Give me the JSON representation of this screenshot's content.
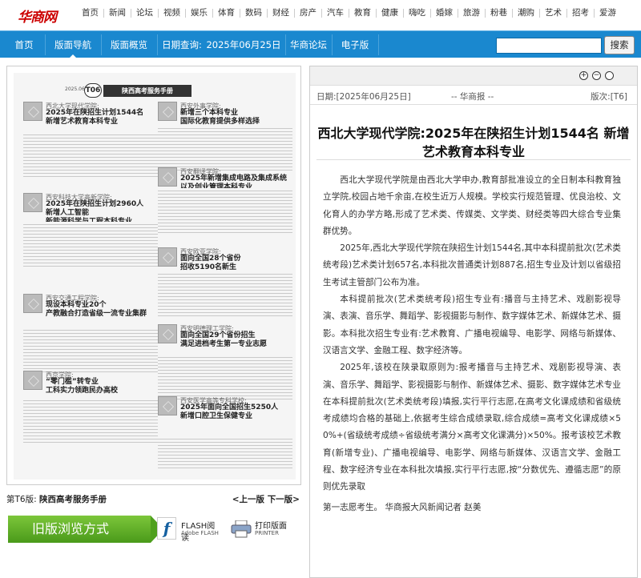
{
  "site": {
    "logo_text": "华商网"
  },
  "topnav": [
    "首页",
    "新闻",
    "论坛",
    "视频",
    "娱乐",
    "体育",
    "数码",
    "财经",
    "房产",
    "汽车",
    "教育",
    "健康",
    "嗨吃",
    "婚嫁",
    "旅游",
    "粉巷",
    "潮购",
    "艺术",
    "招考",
    "爱游"
  ],
  "bluebar": {
    "home": "首页",
    "guide": "版面导航",
    "overview": "版面概览",
    "date_label": "日期查询:",
    "date_value": "2025年06月25日",
    "forum": "华商论坛",
    "epaper": "电子版",
    "search_button": "搜索",
    "search_placeholder": ""
  },
  "paper": {
    "date": "2025.06.25",
    "version_badge": "T06",
    "section_title": "陕西高考服务手册",
    "articles": [
      {
        "source": "西北大学现代学院:",
        "title": "2025年在陕招生计划1544名\n新增艺术教育本科专业"
      },
      {
        "source": "西安外事学院:",
        "title": "新增三个本科专业\n国际化教育提供多样选择"
      },
      {
        "source": "西安翻译学院:",
        "title": "2025年新增集成电路及集成系统\n以及创业管理本科专业"
      },
      {
        "source": "西安科技大学高新学院:",
        "title": "2025年在陕招生计划2960人\n新增人工智能\n新能源科学与工程本科专业"
      },
      {
        "source": "西安欧亚学院:",
        "title": "面向全国28个省份\n招收5190名新生"
      },
      {
        "source": "西安交通工程学院:",
        "title": "现设本科专业20个\n产教融合打造省级一流专业集群"
      },
      {
        "source": "西安明德理工学院:",
        "title": "面向全国29个省份招生\n满足进档考生第一专业志愿"
      },
      {
        "source": "西京学院:",
        "title": "“零门槛”转专业\n工科实力领跑民办高校"
      },
      {
        "source": "西安医学高等专科学校:",
        "title": "2025年面向全国招生5250人\n新增口腔卫生保健专业"
      }
    ]
  },
  "caption": {
    "version_name": "第T6版:",
    "section": "陕西高考服务手册",
    "prev": "<上一版",
    "next": "下一版>"
  },
  "tools": {
    "old_view": "旧版浏览方式",
    "flash_label": "FLASH阅读",
    "flash_sub": "Adobe FLASH",
    "print_label": "打印版面",
    "print_sub": "PRINTER"
  },
  "article": {
    "date": "日期:[2025年06月25日]",
    "source": "-- 华商报 --",
    "version": "版次:[T6]",
    "title": "西北大学现代学院:2025年在陕招生计划1544名 新增艺术教育本科专业",
    "paragraphs": [
      "西北大学现代学院是由西北大学申办,教育部批准设立的全日制本科教育独立学院,校园占地千余亩,在校生近万人规模。学校实行规范管理、优良治校、文化育人的办学方略,形成了艺术类、传媒类、文学类、财经类等四大综合专业集群优势。",
      "2025年,西北大学现代学院在陕招生计划1544名,其中本科提前批次(艺术类统考段)艺术类计划657名,本科批次普通类计划887名,招生专业及计划以省级招生考试主管部门公布为准。",
      "本科提前批次(艺术类统考段)招生专业有:播音与主持艺术、戏剧影视导演、表演、音乐学、舞蹈学、影视摄影与制作、数字媒体艺术、新媒体艺术、摄影。本科批次招生专业有:艺术教育、广播电视编导、电影学、网络与新媒体、汉语言文学、金融工程、数字经济等。",
      "2025年,该校在陕录取原则为:报考播音与主持艺术、戏剧影视导演、表演、音乐学、舞蹈学、影视摄影与制作、新媒体艺术、摄影、数字媒体艺术专业在本科提前批次(艺术类统考段)填报,实行平行志愿,在高考文化课成绩和省级统考成绩均合格的基础上,依据考生综合成绩录取,综合成绩=高考文化课成绩×50%+(省级统考成绩÷省级统考满分×高考文化课满分)×50%。报考该校艺术教育(新增专业)、广播电视编导、电影学、网络与新媒体、汉语言文学、金融工程、数字经济专业在本科批次填报,实行平行志愿,按“分数优先、遵循志愿”的原则优先录取"
    ],
    "last_line": "第一志愿考生。 华商报大风新闻记者 赵美"
  }
}
